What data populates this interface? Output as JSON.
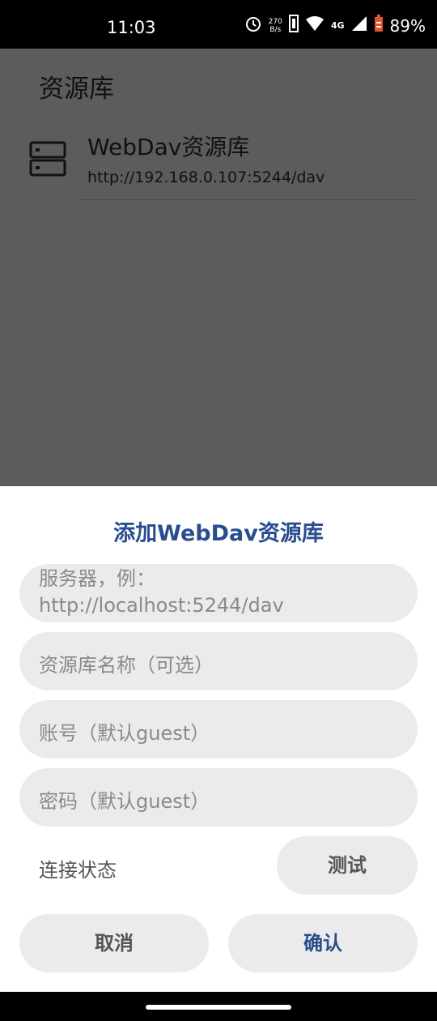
{
  "status_bar": {
    "time": "11:03",
    "net_speed_value": "270",
    "net_speed_unit": "B/s",
    "network": "4G",
    "battery": "89%"
  },
  "app": {
    "title": "资源库",
    "libraries": [
      {
        "name": "WebDav资源库",
        "url": "http://192.168.0.107:5244/dav",
        "icon": "server-icon"
      }
    ]
  },
  "dialog": {
    "title": "添加WebDav资源库",
    "fields": {
      "server": {
        "placeholder": "服务器，例：http://localhost:5244/dav"
      },
      "name": {
        "placeholder": "资源库名称（可选）"
      },
      "account": {
        "placeholder": "账号（默认guest）"
      },
      "password": {
        "placeholder": "密码（默认guest）"
      }
    },
    "status_label": "连接状态",
    "test_label": "测试",
    "cancel_label": "取消",
    "confirm_label": "确认"
  },
  "colors": {
    "accent": "#2a4d8f",
    "scrim": "#5c5c5c",
    "field_bg": "#ebebeb"
  }
}
